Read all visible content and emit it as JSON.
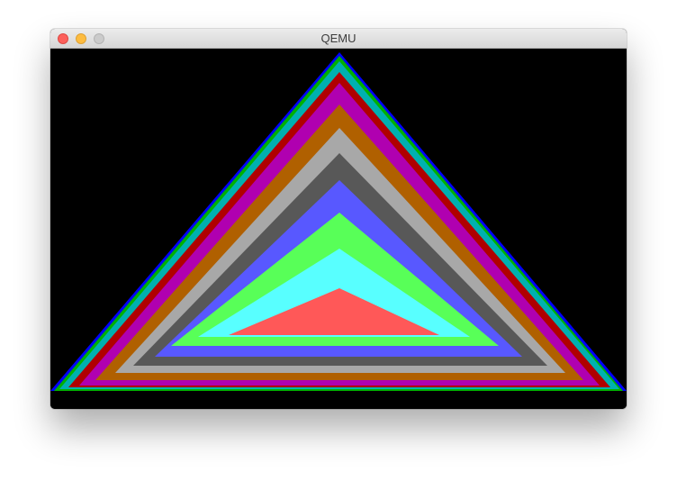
{
  "window": {
    "title": "QEMU"
  },
  "colors": {
    "screen_background": "#000000",
    "triangle_layers": [
      "#0000ff",
      "#00b000",
      "#00b0b0",
      "#b00000",
      "#b000b0",
      "#b06000",
      "#a8a8a8",
      "#585858",
      "#5858ff",
      "#58ff58",
      "#58ffff",
      "#ff5858"
    ]
  }
}
